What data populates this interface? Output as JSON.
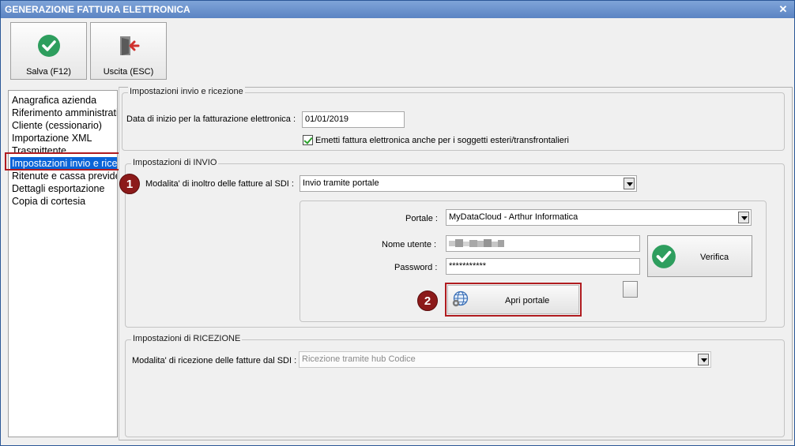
{
  "window": {
    "title": "GENERAZIONE FATTURA ELETTRONICA"
  },
  "toolbar": {
    "save_label": "Salva (F12)",
    "exit_label": "Uscita (ESC)"
  },
  "nav": {
    "items": [
      "Anagrafica azienda",
      "Riferimento amministrativo",
      "Cliente (cessionario)",
      "Importazione XML",
      "Trasmittente",
      "Impostazioni invio e ricezione",
      "Ritenute e cassa previdenziale",
      "Dettagli esportazione",
      "Copia di cortesia"
    ],
    "selected_index": 5
  },
  "general": {
    "group_title": "Impostazioni invio e ricezione",
    "start_date_label": "Data di inizio per la fatturazione elettronica :",
    "start_date_value": "01/01/2019",
    "foreign_checkbox_label": "Emetti fattura elettronica anche per i soggetti esteri/transfrontalieri",
    "foreign_checked": true
  },
  "invio": {
    "group_title": "Impostazioni di INVIO",
    "mode_label": "Modalita' di inoltro delle fatture al SDI :",
    "mode_value": "Invio tramite portale",
    "portal_label": "Portale :",
    "portal_value": "MyDataCloud - Arthur Informatica",
    "username_label": "Nome utente :",
    "password_label": "Password :",
    "password_value": "***********",
    "verify_label": "Verifica",
    "open_portal_label": "Apri portale"
  },
  "ricezione": {
    "group_title": "Impostazioni di RICEZIONE",
    "mode_label": "Modalita' di ricezione delle fatture dal SDI :",
    "mode_value": "Ricezione tramite hub Codice"
  },
  "badges": {
    "one": "1",
    "two": "2"
  },
  "colors": {
    "accent": "#0a64d8",
    "highlight": "#b01c20",
    "check_green": "#2e9e5e"
  }
}
